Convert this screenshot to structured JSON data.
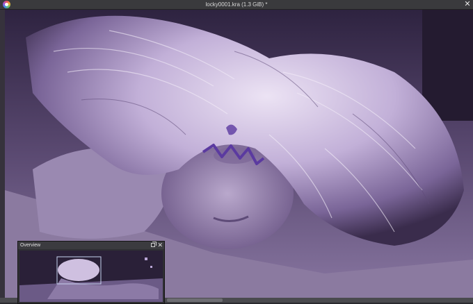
{
  "window": {
    "title": "locky0001.kra (1.3 GiB) *",
    "close_symbol": "✕"
  },
  "overview": {
    "title": "Overview",
    "close_symbol": "✕"
  },
  "icons": {
    "app": "krita-app-icon",
    "float": "float-docker-icon",
    "close": "close-icon"
  },
  "colors": {
    "canvas_tint": "#8e78ac",
    "hair_light": "#e9e0f1",
    "shadow": "#231a2f",
    "paint_stroke": "#5b3aa0"
  }
}
